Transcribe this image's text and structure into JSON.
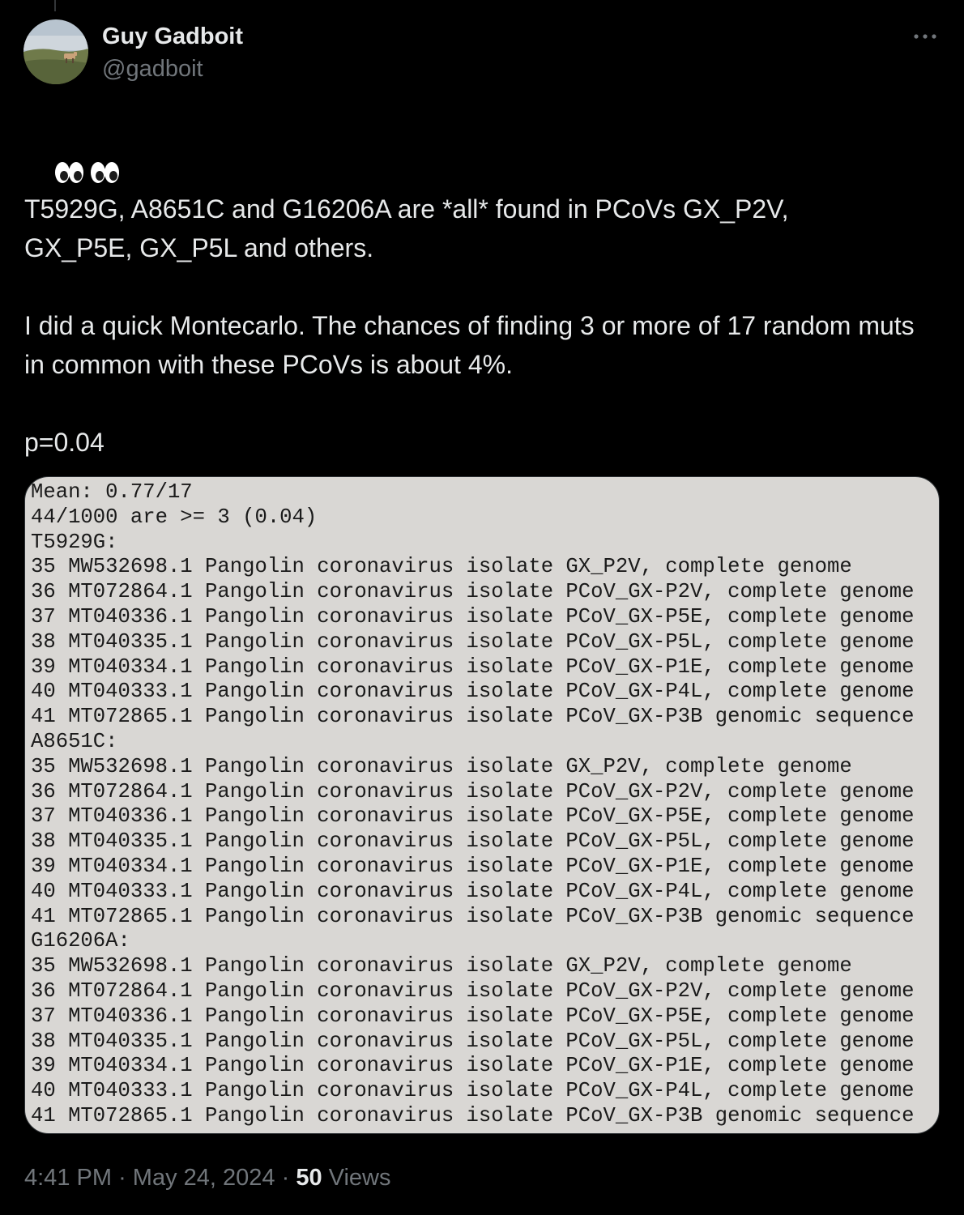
{
  "author": {
    "display_name": "Guy Gadboit",
    "handle": "@gadboit"
  },
  "tweet": {
    "emoji": "👀👀",
    "paragraphs": [
      "T5929G, A8651C and G16206A are *all* found in PCoVs GX_P2V, GX_P5E, GX_P5L and others.",
      "I did a quick Montecarlo. The chances of finding 3 or more of 17 random muts in common with these PCoVs is about 4%.",
      "p=0.04"
    ]
  },
  "attachment": {
    "lines": [
      "Mean: 0.77/17",
      "44/1000 are >= 3 (0.04)",
      "T5929G:",
      "35 MW532698.1 Pangolin coronavirus isolate GX_P2V, complete genome",
      "36 MT072864.1 Pangolin coronavirus isolate PCoV_GX-P2V, complete genome",
      "37 MT040336.1 Pangolin coronavirus isolate PCoV_GX-P5E, complete genome",
      "38 MT040335.1 Pangolin coronavirus isolate PCoV_GX-P5L, complete genome",
      "39 MT040334.1 Pangolin coronavirus isolate PCoV_GX-P1E, complete genome",
      "40 MT040333.1 Pangolin coronavirus isolate PCoV_GX-P4L, complete genome",
      "41 MT072865.1 Pangolin coronavirus isolate PCoV_GX-P3B genomic sequence",
      "A8651C:",
      "35 MW532698.1 Pangolin coronavirus isolate GX_P2V, complete genome",
      "36 MT072864.1 Pangolin coronavirus isolate PCoV_GX-P2V, complete genome",
      "37 MT040336.1 Pangolin coronavirus isolate PCoV_GX-P5E, complete genome",
      "38 MT040335.1 Pangolin coronavirus isolate PCoV_GX-P5L, complete genome",
      "39 MT040334.1 Pangolin coronavirus isolate PCoV_GX-P1E, complete genome",
      "40 MT040333.1 Pangolin coronavirus isolate PCoV_GX-P4L, complete genome",
      "41 MT072865.1 Pangolin coronavirus isolate PCoV_GX-P3B genomic sequence",
      "G16206A:",
      "35 MW532698.1 Pangolin coronavirus isolate GX_P2V, complete genome",
      "36 MT072864.1 Pangolin coronavirus isolate PCoV_GX-P2V, complete genome",
      "37 MT040336.1 Pangolin coronavirus isolate PCoV_GX-P5E, complete genome",
      "38 MT040335.1 Pangolin coronavirus isolate PCoV_GX-P5L, complete genome",
      "39 MT040334.1 Pangolin coronavirus isolate PCoV_GX-P1E, complete genome",
      "40 MT040333.1 Pangolin coronavirus isolate PCoV_GX-P4L, complete genome",
      "41 MT072865.1 Pangolin coronavirus isolate PCoV_GX-P3B genomic sequence"
    ]
  },
  "meta": {
    "time": "4:41 PM",
    "separator": "·",
    "date": "May 24, 2024",
    "views_count": "50",
    "views_label": "Views"
  },
  "icons": {
    "more": "more-horizontal-icon",
    "eyes": "eyes-icon"
  },
  "colors": {
    "background": "#000000",
    "primary_text": "#e7e9ea",
    "secondary_text": "#71767b",
    "attachment_bg": "#d9d7d4"
  }
}
